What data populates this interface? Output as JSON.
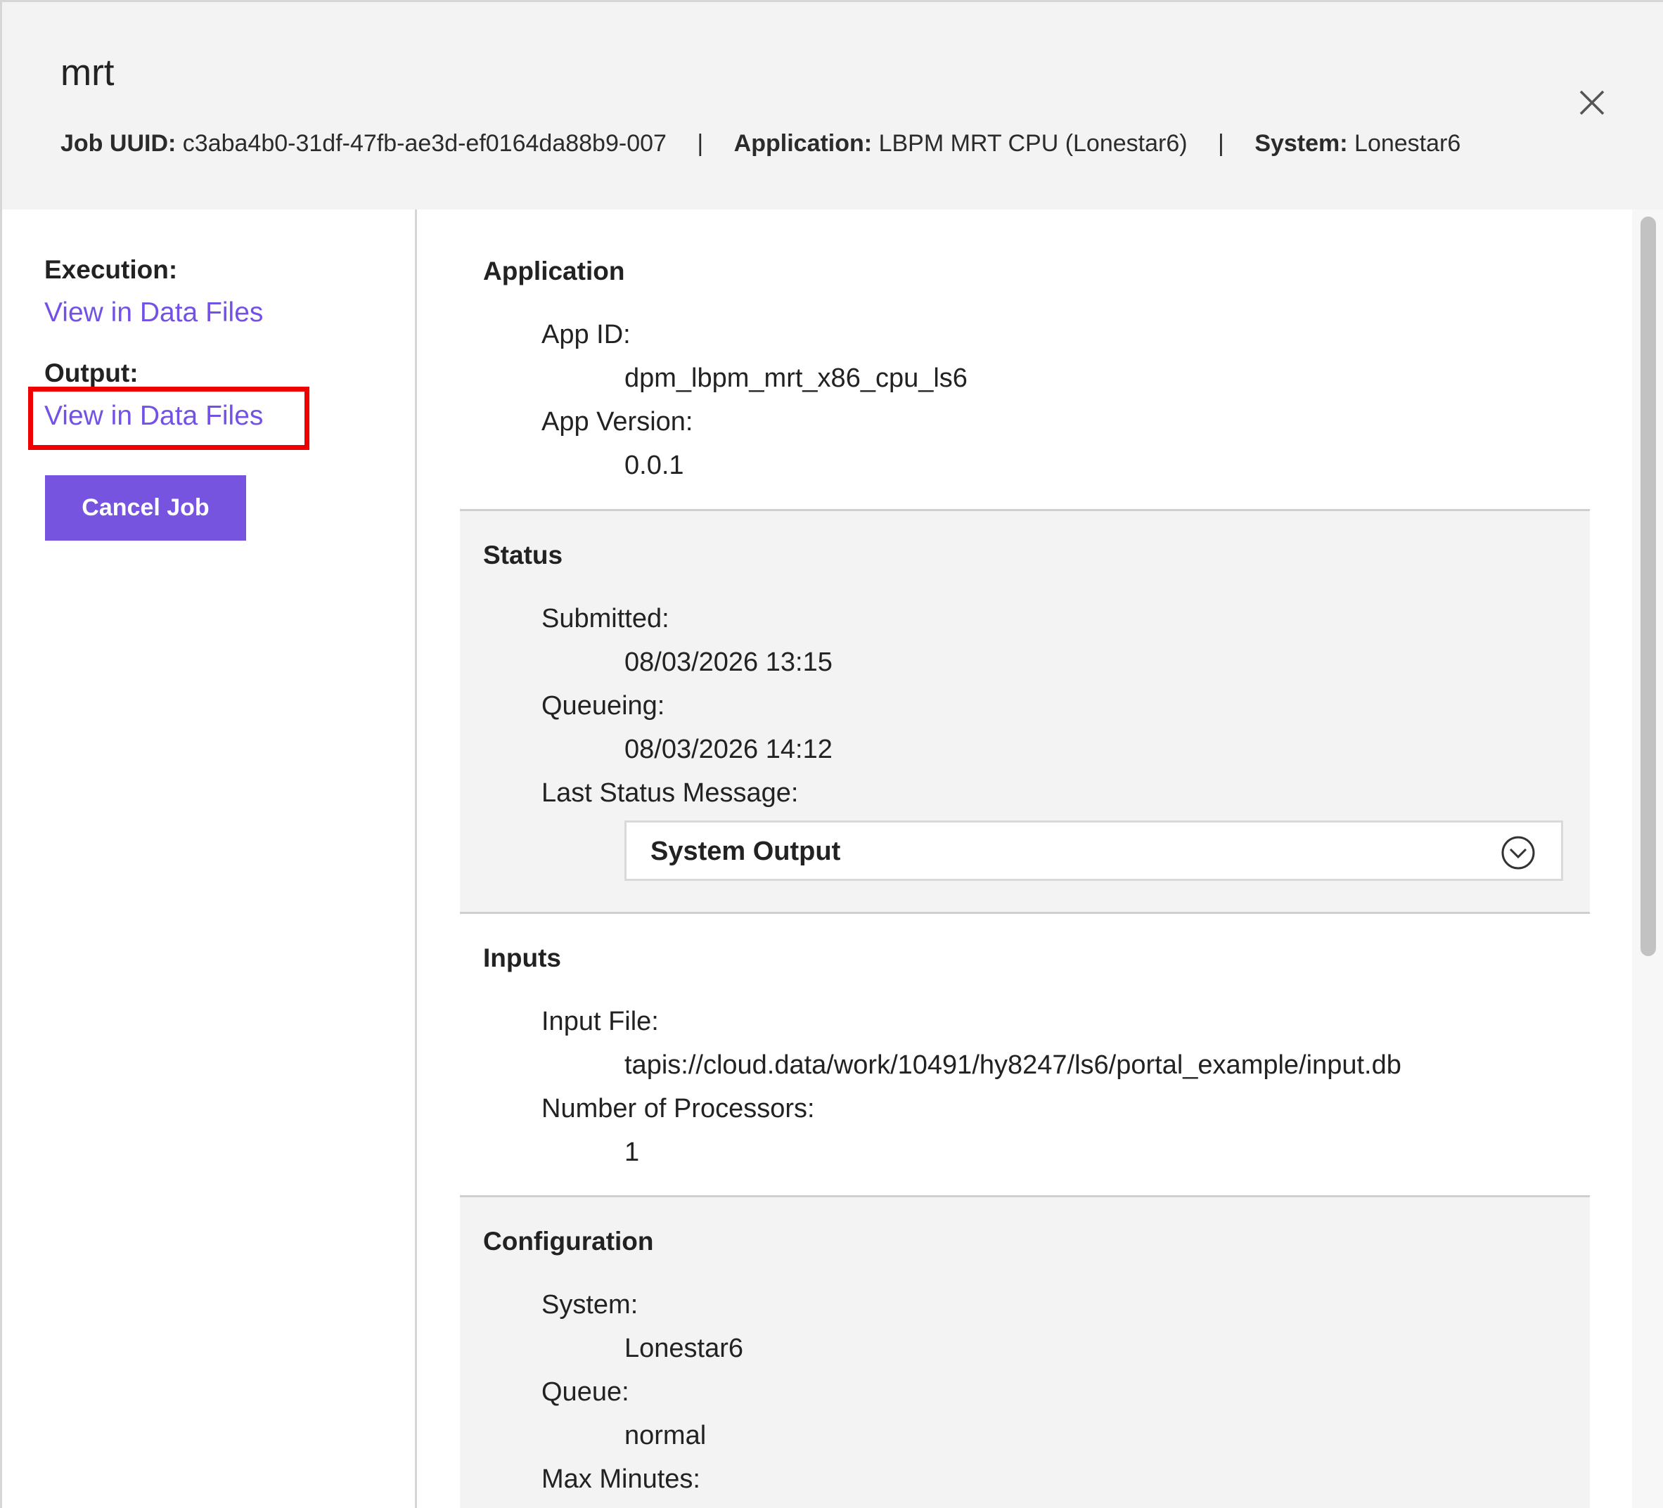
{
  "header": {
    "title": "mrt",
    "job_uuid_label": "Job UUID:",
    "job_uuid": "c3aba4b0-31df-47fb-ae3d-ef0164da88b9-007",
    "separator": "|",
    "application_label": "Application:",
    "application": "LBPM MRT CPU (Lonestar6)",
    "system_label": "System:",
    "system": "Lonestar6",
    "close_icon": "close-icon"
  },
  "sidebar": {
    "execution_label": "Execution:",
    "execution_link": "View in Data Files",
    "output_label": "Output:",
    "output_link": "View in Data Files",
    "cancel_button": "Cancel Job",
    "accent_color": "#7451e6",
    "highlight_color": "#ee0000"
  },
  "sections": {
    "application": {
      "title": "Application",
      "app_id_label": "App ID:",
      "app_id": "dpm_lbpm_mrt_x86_cpu_ls6",
      "app_version_label": "App Version:",
      "app_version": "0.0.1"
    },
    "status": {
      "title": "Status",
      "submitted_label": "Submitted:",
      "submitted": "08/03/2026 13:15",
      "queueing_label": "Queueing:",
      "queueing": "08/03/2026 14:12",
      "last_status_label": "Last Status Message:",
      "dropdown_label": "System Output",
      "dropdown_icon": "chevron-down-circle-icon"
    },
    "inputs": {
      "title": "Inputs",
      "input_file_label": "Input File:",
      "input_file": "tapis://cloud.data/work/10491/hy8247/ls6/portal_example/input.db",
      "num_procs_label": "Number of Processors:",
      "num_procs": "1"
    },
    "configuration": {
      "title": "Configuration",
      "system_label": "System:",
      "system": "Lonestar6",
      "queue_label": "Queue:",
      "queue": "normal",
      "max_minutes_label": "Max Minutes:"
    }
  }
}
